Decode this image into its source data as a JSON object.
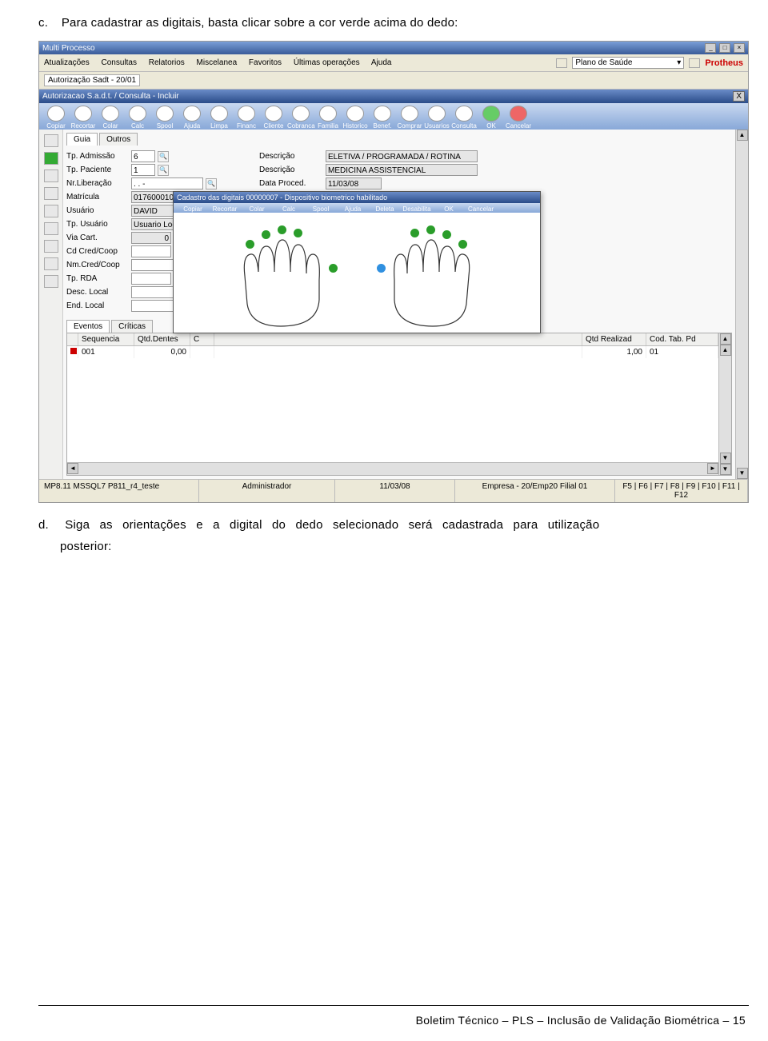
{
  "instruction_c_prefix": "c.",
  "instruction_c": "Para cadastrar as digitais, basta clicar sobre a cor verde acima do dedo:",
  "instruction_d_prefix": "d.",
  "instruction_d_line1": "Siga as orientações e a digital do dedo selecionado será cadastrada para utilização",
  "instruction_d_line2": "posterior:",
  "window": {
    "title": "Multi Processo",
    "menus": [
      "Atualizações",
      "Consultas",
      "Relatorios",
      "Miscelanea",
      "Favoritos",
      "Últimas operações",
      "Ajuda"
    ],
    "plano": "Plano de Saúde",
    "logo": "Protheus",
    "subpath": "Autorização Sadt - 20/01",
    "inner_title": "Autorizacao S.a.d.t. / Consulta - Incluir",
    "close_x": "X"
  },
  "toolbar": {
    "main": [
      "Copiar",
      "Recortar",
      "Colar",
      "Calc",
      "Spool",
      "Ajuda",
      "Limpa",
      "Financ",
      "Cliente",
      "Cobranca",
      "Familia",
      "Historico",
      "Benef.",
      "Comprar",
      "Usuarios",
      "Consulta",
      "OK",
      "Cancelar"
    ],
    "popup": [
      "Copiar",
      "Recortar",
      "Colar",
      "Calc",
      "Spool",
      "Ajuda",
      "Deleta",
      "Desabilita",
      "OK",
      "Cancelar"
    ]
  },
  "tabs": {
    "guia": "Guia",
    "outros": "Outros"
  },
  "form": {
    "tp_admissao_lbl": "Tp. Admissão",
    "tp_admissao": "6",
    "tp_paciente_lbl": "Tp. Paciente",
    "tp_paciente": "1",
    "nr_liberacao_lbl": "Nr.Liberação",
    "nr_liberacao": ".   .   -",
    "matricula_lbl": "Matrícula",
    "matricula": "01760001000005006",
    "usuario_lbl": "Usuário",
    "usuario": "DAVID",
    "tp_usuario_lbl": "Tp. Usuário",
    "tp_usuario": "Usuario Local",
    "via_cart_lbl": "Via Cart.",
    "via_cart": "0",
    "cdcred_lbl": "Cd Cred/Coop",
    "nmcred_lbl": "Nm.Cred/Coop",
    "tp_rda_lbl": "Tp. RDA",
    "desc_local_lbl": "Desc. Local",
    "end_local_lbl": "End. Local",
    "descricao_lbl": "Descrição",
    "desc1": "ELETIVA / PROGRAMADA / ROTINA",
    "desc2": "MEDICINA ASSISTENCIAL",
    "data_proced_lbl": "Data Proced.",
    "data_proced": "11/03/08"
  },
  "popup": {
    "title": "Cadastro das digitais 00000007 - Dispositivo biometrico habilitado"
  },
  "events": {
    "tab_eventos": "Eventos",
    "tab_criticas": "Críticas",
    "col_seq": "Sequencia",
    "col_qtd": "Qtd.Dentes",
    "col_c": "C",
    "col_qtd_real": "Qtd Realizad",
    "col_cod": "Cod. Tab. Pd",
    "row_seq": "001",
    "row_qtd": "0,00",
    "row_qtdreal": "1,00",
    "row_cod": "01"
  },
  "status": {
    "c1": "MP8.11  MSSQL7 P811_r4_teste",
    "c2": "Administrador",
    "c3": "11/03/08",
    "c4": "Empresa - 20/Emp20 Filial 01",
    "c5": "F5 | F6 | F7 | F8 | F9 | F10 | F11 | F12"
  },
  "footer": "Boletim Técnico – PLS – Inclusão de Validação Biométrica – 15"
}
